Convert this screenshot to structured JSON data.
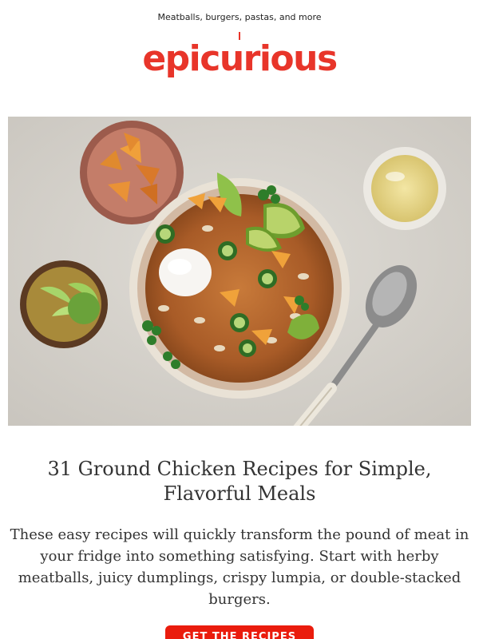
{
  "email": {
    "preheader": "Meatballs, burgers, pastas, and more",
    "brand": {
      "logo_text": "epicurious",
      "color": "#e8352a"
    },
    "hero": {
      "alt": "Bowl of ground chicken chili topped with sour cream, jalapeños, avocado, lime, cilantro and corn chips"
    },
    "article": {
      "headline": "31 Ground Chicken Recipes for Simple, Flavorful Meals",
      "body": "These easy recipes will quickly transform the pound of meat in your fridge into something satisfying. Start with herby meatballs, juicy dumplings, crispy lumpia, or double-stacked burgers.",
      "cta_label": "GET THE RECIPES",
      "cta_color": "#ea1c0d"
    }
  }
}
